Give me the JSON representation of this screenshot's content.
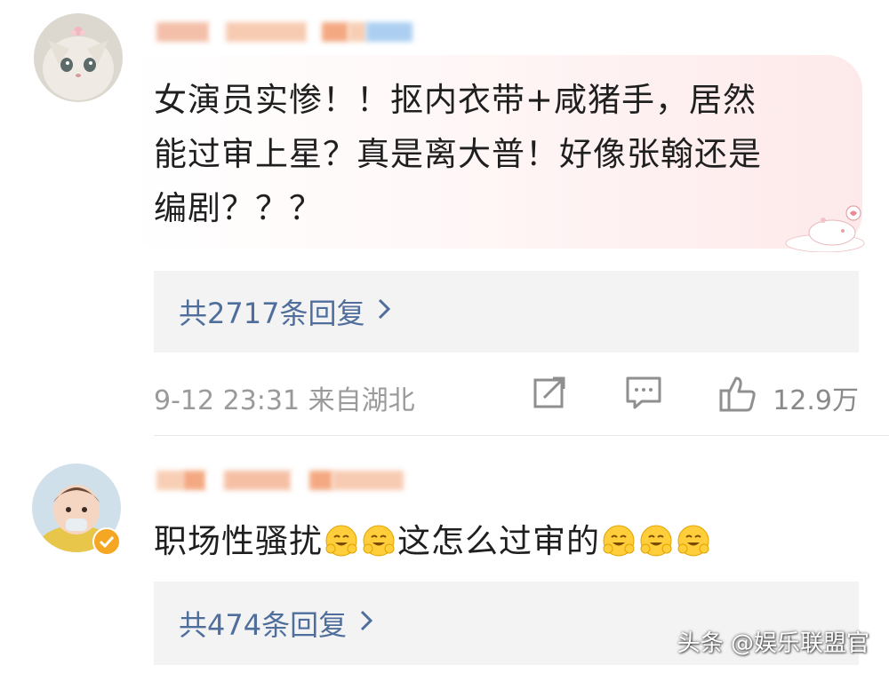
{
  "comments": [
    {
      "text": "女演员实惨！！抠内衣带+咸猪手，居然能过审上星？真是离大普！好像张翰还是编剧？？？",
      "lines": [
        "女演员实惨！！抠内衣带+咸猪手，居然",
        "能过审上星？真是离大普！好像张翰还是",
        "编剧？？？"
      ],
      "replies_label": "共2717条回复",
      "time_location": "9-12 23:31 来自湖北",
      "like_count": "12.9万"
    },
    {
      "text_prefix": "职场性骚扰",
      "text_middle": "这怎么过审的",
      "emoji_name": "hugging-face-emoji",
      "replies_label": "共474条回复"
    }
  ],
  "icons": {
    "share": "share-icon",
    "comment": "comment-icon",
    "like": "thumbs-up-icon",
    "chevron": "chevron-right-icon",
    "verified": "verified-badge-icon"
  },
  "colors": {
    "link": "#4f6e9c",
    "meta": "#9a9a9a",
    "reply_bg": "#f3f3f3",
    "bubble_tint": "#fde9ea",
    "verified": "#f5a623"
  },
  "watermark": "头条 @娱乐联盟官"
}
